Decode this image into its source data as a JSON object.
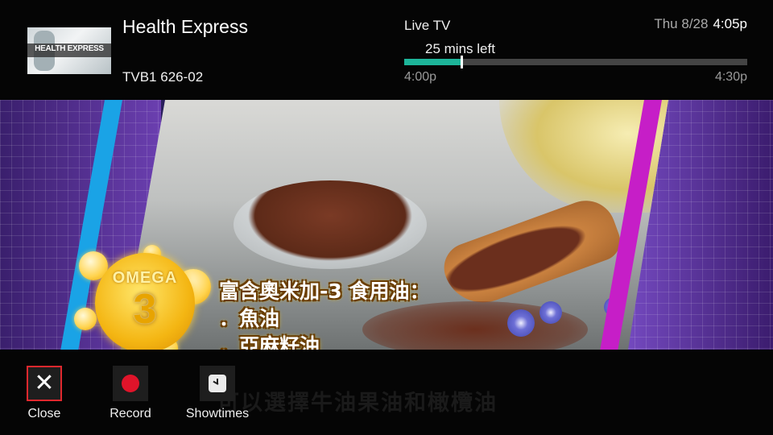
{
  "header": {
    "thumbnail_text": "HEALTH EXPRESS",
    "show_title": "Health Express",
    "channel": "TVB1 626-02",
    "live_label": "Live TV",
    "time_remaining": "25 mins left",
    "date": "Thu 8/28",
    "time": "4:05p",
    "start_time": "4:00p",
    "end_time": "4:30p",
    "progress_fraction": 0.167
  },
  "video": {
    "badge_word": "OMEGA",
    "badge_number": "3",
    "caption_lines": [
      "富含奧米加-3 食用油：",
      "．魚油",
      "．亞麻籽油"
    ],
    "background_subtitle": "可以選擇牛油果油和橄欖油"
  },
  "actions": [
    {
      "label": "Close",
      "icon": "close-icon",
      "focused": true
    },
    {
      "label": "Record",
      "icon": "record-icon",
      "focused": false
    },
    {
      "label": "Showtimes",
      "icon": "clock-icon",
      "focused": false
    }
  ],
  "colors": {
    "progress_fill": "#1db59a",
    "focus_border": "#e0282e",
    "record_red": "#e0142a"
  }
}
